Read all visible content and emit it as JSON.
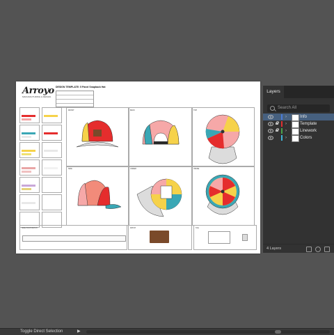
{
  "artboard": {
    "logo": "Arroyo",
    "logo_sub": "MANUFACTURING & DESIGN",
    "title": "DESIGN TEMPLATE: 5 Panel Snapback Hat",
    "views": [
      {
        "label": "FRONT"
      },
      {
        "label": "BACK"
      },
      {
        "label": "TOP"
      },
      {
        "label": "SIDE"
      },
      {
        "label": "UNDER"
      },
      {
        "label": "INSIDE"
      }
    ],
    "bottom_labels": {
      "strip": "SIDE PRINT/PATCH",
      "patch": "PATCH",
      "tag": "TAG"
    }
  },
  "layers_panel": {
    "tab_label": "Layers",
    "search_placeholder": "Search All",
    "layers": [
      {
        "name": "Info",
        "color": "#4a7bd8",
        "selected": true,
        "locked": false
      },
      {
        "name": "Template",
        "color": "#e03030",
        "selected": false,
        "locked": true
      },
      {
        "name": "Linework",
        "color": "#4aa34a",
        "selected": false,
        "locked": true
      },
      {
        "name": "Colors",
        "color": "#3fb5d6",
        "selected": false,
        "locked": false
      }
    ],
    "layer_count": "4 Layers"
  },
  "status_bar": {
    "tool_text": "Toggle Direct Selection",
    "arrow": "▶"
  }
}
